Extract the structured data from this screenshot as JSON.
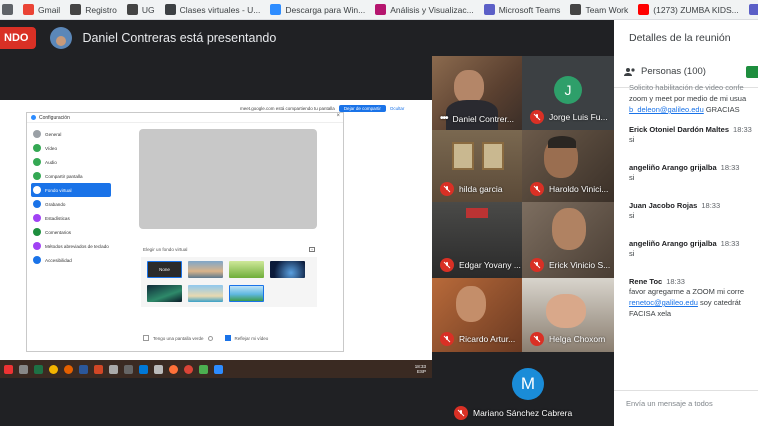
{
  "bookmarks": [
    {
      "label": "",
      "icon": "grid-apps-icon",
      "color": "#5f6368"
    },
    {
      "label": "Gmail",
      "icon": "gmail-icon",
      "color": "#ea4335"
    },
    {
      "label": "Registro",
      "icon": "registro-icon",
      "color": "#444444"
    },
    {
      "label": "UG",
      "icon": "ug-icon",
      "color": "#444444"
    },
    {
      "label": "Clases virtuales - U...",
      "icon": "clases-virtuales-icon",
      "color": "#3c4043"
    },
    {
      "label": "Descarga para Win...",
      "icon": "zoom-icon",
      "color": "#2d8cff"
    },
    {
      "label": "Análisis y Visualizac...",
      "icon": "edx-icon",
      "color": "#b5156e"
    },
    {
      "label": "Microsoft Teams",
      "icon": "teams-icon",
      "color": "#5b5fc7"
    },
    {
      "label": "Team Work",
      "icon": "teamwork-icon",
      "color": "#444444"
    },
    {
      "label": "(1273) ZUMBA KIDS...",
      "icon": "youtube-icon",
      "color": "#ff0000"
    },
    {
      "label": "MicrosoftTeams",
      "icon": "teams-icon-2",
      "color": "#5b5fc7"
    }
  ],
  "presenting": {
    "badge": "NDO",
    "text": "Daniel Contreras está presentando"
  },
  "shared_screen": {
    "notice": "meet.google.com está compartiendo tu pantalla",
    "stop_label": "Dejar de compartir",
    "hide_label": "Ocultar",
    "window_title": "Configuración",
    "close_glyph": "×",
    "menu": [
      {
        "label": "General",
        "color": "#9aa0a6"
      },
      {
        "label": "Vídeo",
        "color": "#34a853"
      },
      {
        "label": "Audio",
        "color": "#34a853"
      },
      {
        "label": "Compartir pantalla",
        "color": "#34a853"
      },
      {
        "label": "Fondo virtual",
        "color": "#1a73e8",
        "active": true
      },
      {
        "label": "Grabando",
        "color": "#1a73e8"
      },
      {
        "label": "Estadísticas",
        "color": "#a142f4"
      },
      {
        "label": "Comentarios",
        "color": "#1e8e3e"
      },
      {
        "label": "Métodos abreviados de teclado",
        "color": "#a142f4"
      },
      {
        "label": "Accesibilidad",
        "color": "#1a73e8"
      }
    ],
    "bg_label": "Elegir un fondo virtual",
    "add_glyph": "+",
    "thumb_none": "None",
    "check_green": "Tengo una pantalla verde",
    "check_mirror": "Reflejar mi vídeo",
    "clock_time": "18:33",
    "clock_lang": "ESP"
  },
  "participants": [
    {
      "name": "Daniel Contrer...",
      "muted": false
    },
    {
      "name": "Jorge Luis Fu...",
      "muted": true,
      "avatar_letter": "J",
      "avatar_color": "#2e9f6a"
    },
    {
      "name": "hilda garcia",
      "muted": true
    },
    {
      "name": "Haroldo Vinici...",
      "muted": true
    },
    {
      "name": "Edgar Yovany ...",
      "muted": true
    },
    {
      "name": "Erick Vinicio S...",
      "muted": true
    },
    {
      "name": "Ricardo Artur...",
      "muted": true
    },
    {
      "name": "Helga Choxom",
      "muted": true
    },
    {
      "name": "Mariano Sánchez Cabrera",
      "muted": true,
      "avatar_letter": "M",
      "avatar_color": "#1a8cd8"
    }
  ],
  "panel": {
    "title": "Detalles de la reunión",
    "people_tab": "Personas (100)",
    "chat_input_placeholder": "Envía un mensaje a todos",
    "messages": [
      {
        "lines": [
          "zoom y meet por medio de mi usua"
        ],
        "partial_top": "Solicito habilitación de video confe",
        "link": "b_deleon@galileo.edu",
        "after_link": " GRACIAS"
      },
      {
        "author": "Erick Otoniel Dardón Maltes",
        "time": "18:33",
        "text": "si"
      },
      {
        "author": "angeliño Arango grijalba",
        "time": "18:33",
        "text": "si"
      },
      {
        "author": "Juan Jacobo Rojas",
        "time": "18:33",
        "text": "si"
      },
      {
        "author": "angeliño Arango grijalba",
        "time": "18:33",
        "text": "si"
      },
      {
        "author": "Rene Toc",
        "time": "18:33",
        "line1": "favor agregarme a ZOOM  mi corre",
        "link": "renetoc@galileo.edu",
        "after_link": "  soy catedrát",
        "line3": "FACISA xela"
      }
    ]
  }
}
